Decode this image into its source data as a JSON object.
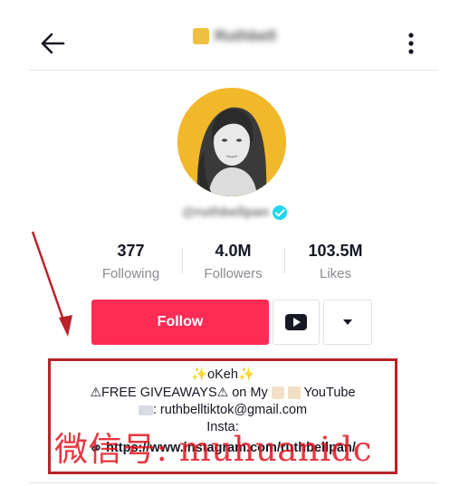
{
  "header": {
    "title": "Ruthbell",
    "back_icon": "back-arrow-icon",
    "more_icon": "more-vertical-icon"
  },
  "profile": {
    "handle": "@ruthbellpan",
    "verified": true
  },
  "stats": [
    {
      "value": "377",
      "label": "Following"
    },
    {
      "value": "4.0M",
      "label": "Followers"
    },
    {
      "value": "103.5M",
      "label": "Likes"
    }
  ],
  "actions": {
    "follow_label": "Follow",
    "youtube_icon": "youtube-icon",
    "dropdown_icon": "caret-down-icon"
  },
  "bio": {
    "line1": "oKeh",
    "line2_a": "FREE GIVEAWAYS",
    "line2_b": " on My ",
    "line2_c": " YouTube",
    "line3": ": ruthbelltiktok@gmail.com",
    "line4": "Insta:",
    "link": "https://www.instagram.com/ruthbellpan/"
  },
  "overlay": {
    "watermark": "微信号: muhuanidc"
  },
  "colors": {
    "follow": "#fe2c55",
    "annotation_red": "#b8232a",
    "avatar_bg": "#f1b82b",
    "verified": "#20d5ec"
  }
}
